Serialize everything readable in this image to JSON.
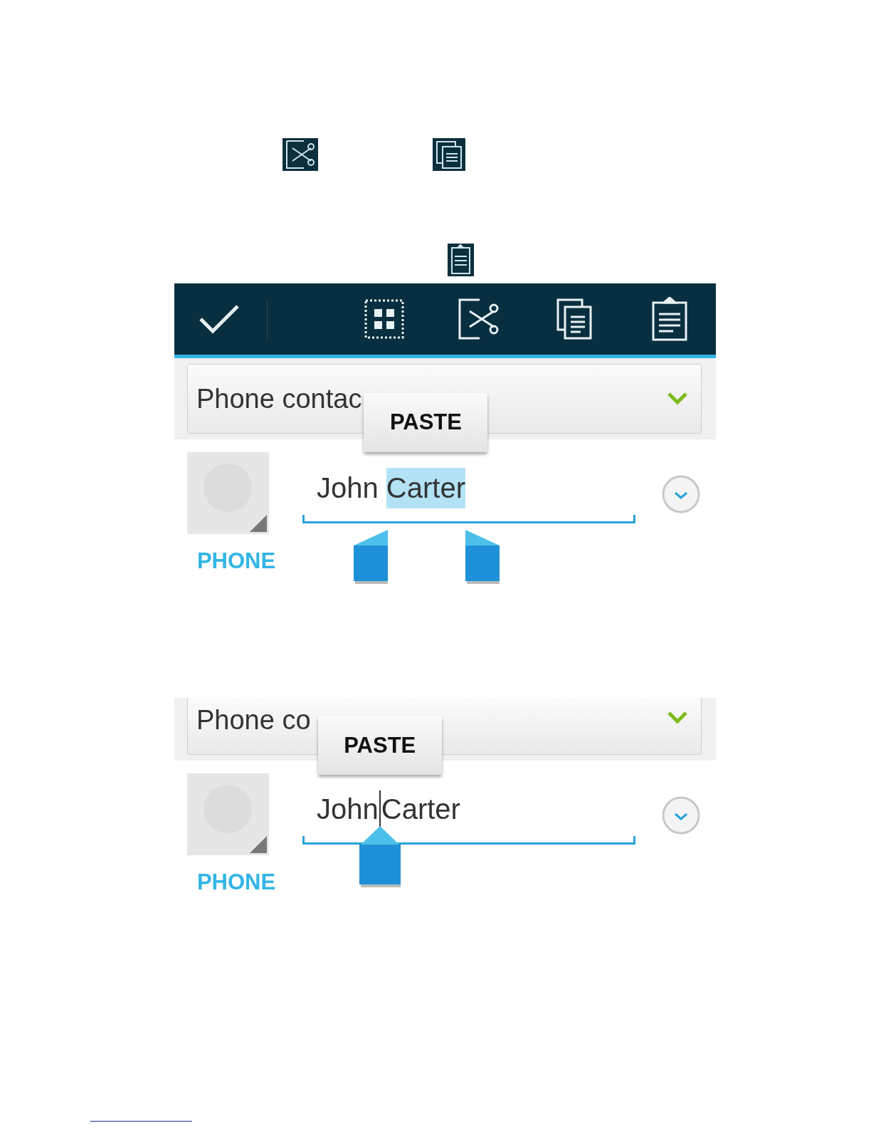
{
  "doc_icons": [
    {
      "kind": "cut"
    },
    {
      "kind": "copy"
    },
    {
      "kind": "paste"
    }
  ],
  "screens": [
    {
      "toolbar": [
        {
          "kind": "done"
        },
        {
          "kind": "select_all"
        },
        {
          "kind": "cut"
        },
        {
          "kind": "copy"
        },
        {
          "kind": "paste"
        }
      ],
      "dropdown": "Phone contac",
      "kind": "selection",
      "popup": "PASTE",
      "name_parts": [
        {
          "text": "John ",
          "selected": false
        },
        {
          "text": "Carter",
          "selected": true
        }
      ],
      "label": "PHONE"
    },
    {
      "dropdown": "Phone co",
      "kind": "cursor",
      "popup": "PASTE",
      "name_parts": [
        {
          "text": "John",
          "selected": false
        },
        {
          "text": "Carter",
          "selected": false
        }
      ],
      "label": "PHONE"
    }
  ]
}
